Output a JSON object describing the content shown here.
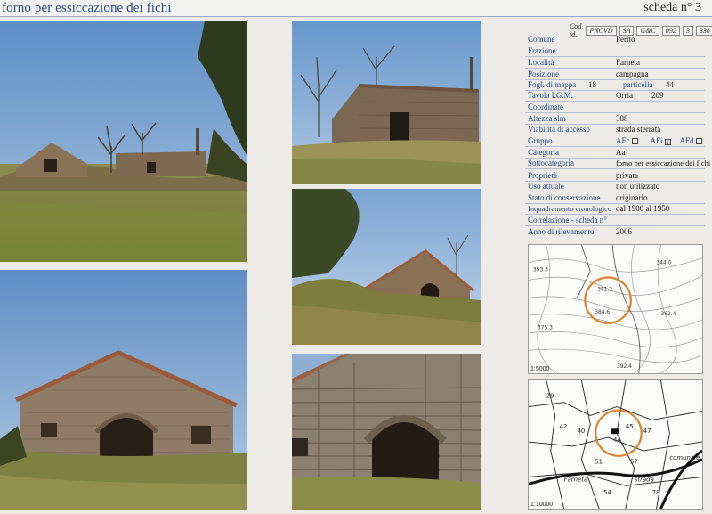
{
  "header": {
    "title": "forno per essiccazione dei fichi",
    "sheet": "scheda  n° 3"
  },
  "code": {
    "prefix": "Cod. id.",
    "parts": [
      "PNCVD",
      "SA",
      "G&C",
      "092",
      "3",
      "338"
    ]
  },
  "card": {
    "comune_label": "Comune",
    "comune_value": "Perito",
    "frazione_label": "Frazione",
    "localita_label": "Località",
    "localita_value": "Farneta",
    "posizione_label": "Posizione",
    "posizione_value": "campagna",
    "foglio_label": "Fogl. di mappa",
    "foglio_value": "18",
    "particella_label": "particella",
    "particella_value": "44",
    "tavola_label": "Tavola I.G.M.",
    "tavola_value_1": "Orria",
    "tavola_value_2": "209",
    "coordinate_label": "Coordinate",
    "altezza_label": "Altezza slm",
    "altezza_value": "388",
    "viabilita_label": "Viabilità di accesso",
    "viabilita_value": "strada sterrata",
    "gruppo_label": "Gruppo",
    "gruppo_afc": "AFc",
    "gruppo_afi": "AFi",
    "gruppo_afd": "AFd",
    "gruppo_afi_mark": "x",
    "categoria_label": "Categoria",
    "categoria_value": "Aa",
    "sottocategoria_label": "Sottocategoria",
    "sottocategoria_value": "forno per essiccazione dei fichi",
    "proprieta_label": "Proprietà",
    "proprieta_value": "privata",
    "uso_label": "Uso attuale",
    "uso_value": "non utilizzato",
    "stato_label": "Stato di conservazione",
    "stato_value": "originario",
    "inquadramento_label": "Inquadramento cronologico",
    "inquadramento_value": "dal 1900 al 1950",
    "correlazione_label": "Correlazione - scheda    n°",
    "anno_label": "Anno di rilevamento",
    "anno_value": "2006"
  },
  "maps": {
    "top_scale": "1:5000",
    "bottom_scale": "1:10000",
    "top_labels": [
      "344.0",
      "381.2",
      "384.6",
      "362.4",
      "392.4",
      "375.3",
      "353.3"
    ],
    "bottom_labels": [
      "40",
      "45",
      "44",
      "47",
      "51",
      "57",
      "29",
      "42",
      "54",
      "78",
      "Farneta",
      "strada",
      "comunale"
    ]
  },
  "colors": {
    "title_blue": "#2b4a8a",
    "label_blue": "#2b4a8a",
    "circle_orange": "#d9822b"
  }
}
